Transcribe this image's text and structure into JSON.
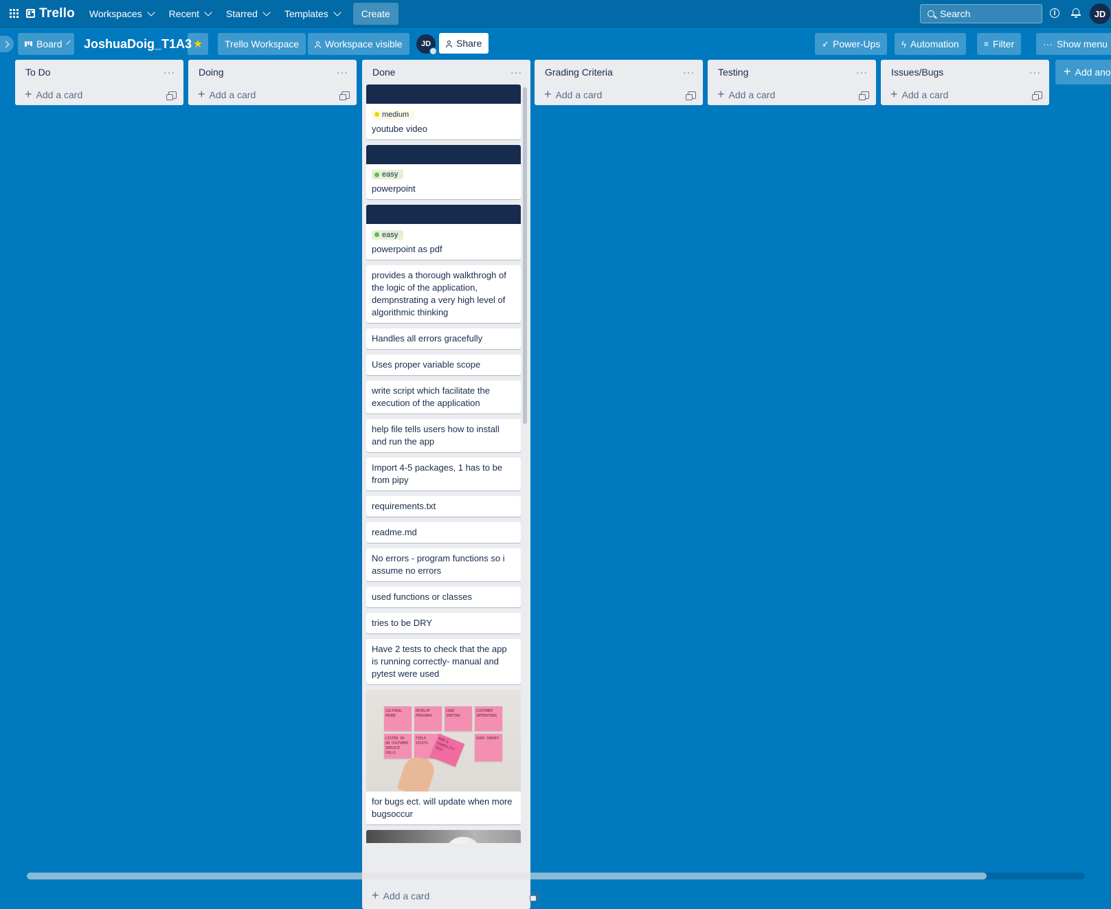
{
  "header": {
    "app_name": "Trello",
    "nav": [
      {
        "label": "Workspaces"
      },
      {
        "label": "Recent"
      },
      {
        "label": "Starred"
      },
      {
        "label": "Templates"
      }
    ],
    "create_label": "Create",
    "search_placeholder": "Search",
    "info_label": "i",
    "avatar_initials": "JD"
  },
  "board": {
    "view_label": "Board",
    "title": "JoshuaDoig_T1A3",
    "starred": true,
    "workspace_label": "Trello Workspace",
    "visibility_label": "Workspace visible",
    "member_initials": "JD",
    "share_label": "Share",
    "powerups_label": "Power-Ups",
    "automation_label": "Automation",
    "filter_label": "Filter",
    "show_menu_label": "Show menu",
    "menu_dots": "···",
    "add_list_label": "Add anot"
  },
  "colors": {
    "board_bg": "#0079bf",
    "header_bg": "#026aa7",
    "list_bg": "#ebecf0",
    "card_cover": "#172b4d",
    "label_medium": "#f2d600",
    "label_easy": "#61bd4f"
  },
  "lists": {
    "todo": {
      "title": "To Do",
      "add_card": "Add a card"
    },
    "doing": {
      "title": "Doing",
      "add_card": "Add a card"
    },
    "done": {
      "title": "Done",
      "add_card": "Add a card",
      "cards": [
        {
          "label": "medium",
          "text": "youtube video"
        },
        {
          "label": "easy",
          "text": "powerpoint"
        },
        {
          "label": "easy",
          "text": "powerpoint as pdf"
        },
        {
          "text": "provides a thorough walkthrogh of the logic of the application, dempnstrating a very high level of algorithmic thinking"
        },
        {
          "text": "Handles all errors gracefully"
        },
        {
          "text": "Uses proper variable scope"
        },
        {
          "text": "write script which facilitate the execution of the application"
        },
        {
          "text": "help file tells users how to install and run the app"
        },
        {
          "text": "Import 4-5 packages, 1 has to be from pipy"
        },
        {
          "text": "requirements.txt"
        },
        {
          "text": "readme.md"
        },
        {
          "text": "No errors - program functions so i assume no errors"
        },
        {
          "text": "used functions or classes"
        },
        {
          "text": "tries to be DRY"
        },
        {
          "text": "Have 2 tests to check that the app is running correctly- manual and pytest were used"
        },
        {
          "text": "for bugs ect. will update when more bugsoccur"
        }
      ],
      "sticky_notes": [
        "CULTURAL PROBE",
        "DEVELOP PERSONAS",
        "CARD SORTING",
        "CUSTOMER INTERVIEWS",
        "LISTEN IN ON CUSTOMER SERVICE CALLS",
        "FIELD VISITS",
        "RUN A USABILITY TEST",
        "USER SURVEY"
      ]
    },
    "grading": {
      "title": "Grading Criteria",
      "add_card": "Add a card"
    },
    "testing": {
      "title": "Testing",
      "add_card": "Add a card"
    },
    "issues": {
      "title": "Issues/Bugs",
      "add_card": "Add a card"
    }
  }
}
